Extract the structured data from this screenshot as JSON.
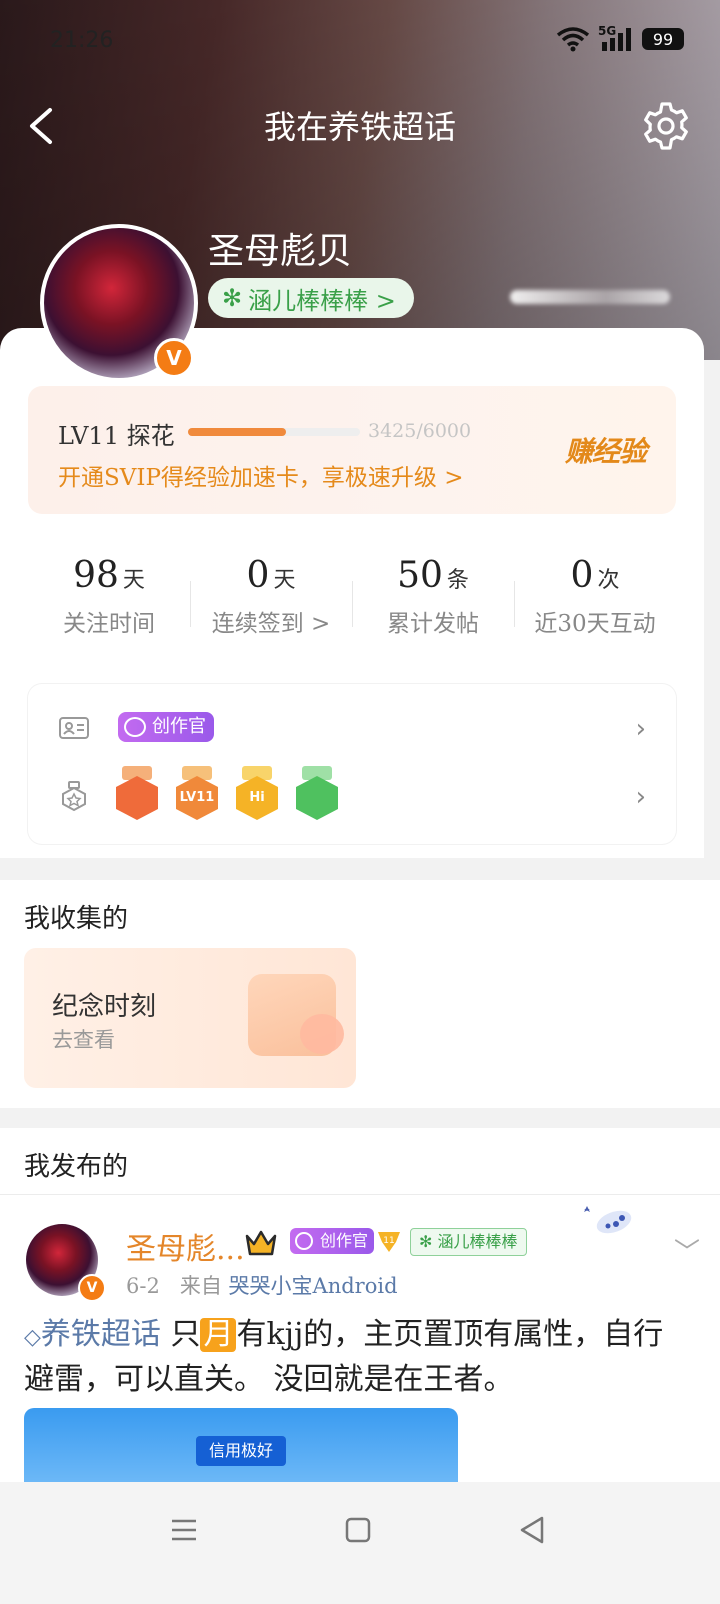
{
  "status_bar": {
    "time": "21:26",
    "network": "5G",
    "battery": "99"
  },
  "header": {
    "title": "我在养铁超话"
  },
  "profile": {
    "name": "圣母彪贝",
    "verified_badge": "V",
    "group_tag": "涵儿棒棒棒 >"
  },
  "level": {
    "name": "LV11 探花",
    "progress_text": "3425/6000",
    "progress_fraction": 0.57,
    "promo": "开通SVIP得经验加速卡，享极速升级 >",
    "earn_label": "赚经验"
  },
  "stats": [
    {
      "value": "98",
      "unit": "天",
      "label": "关注时间"
    },
    {
      "value": "0",
      "unit": "天",
      "label": "连续签到 >"
    },
    {
      "value": "50",
      "unit": "条",
      "label": "累计发帖"
    },
    {
      "value": "0",
      "unit": "次",
      "label": "近30天互动"
    }
  ],
  "honors": {
    "creator_label": "创作官",
    "medals": [
      {
        "icon": "cat-medal",
        "text": "",
        "color": "#ef6b3a"
      },
      {
        "icon": "level-medal",
        "text": "LV11",
        "color": "#f0893a"
      },
      {
        "icon": "hi-medal",
        "text": "Hi",
        "color": "#f5b326"
      },
      {
        "icon": "hands-medal",
        "text": "",
        "color": "#4fc15f"
      }
    ]
  },
  "collected": {
    "section_title": "我收集的",
    "card_title": "纪念时刻",
    "card_subtitle": "去查看"
  },
  "published": {
    "section_title": "我发布的",
    "post": {
      "author": "圣母彪...",
      "creator_label": "创作官",
      "tag": "涵儿棒棒棒",
      "date": "6-2",
      "source_prefix": "来自",
      "source": "哭哭小宝Android",
      "topic": "养铁超话",
      "text_before": " 只",
      "moon": "月",
      "text_after": "有kjj的，主页置顶有属性，自行避雷，可以直关。 没回就是在王者。",
      "image_button": "信用极好"
    }
  },
  "colors": {
    "accent_orange": "#f47c14",
    "topic_blue": "#5b7aa8",
    "green_tag": "#3aa049"
  }
}
